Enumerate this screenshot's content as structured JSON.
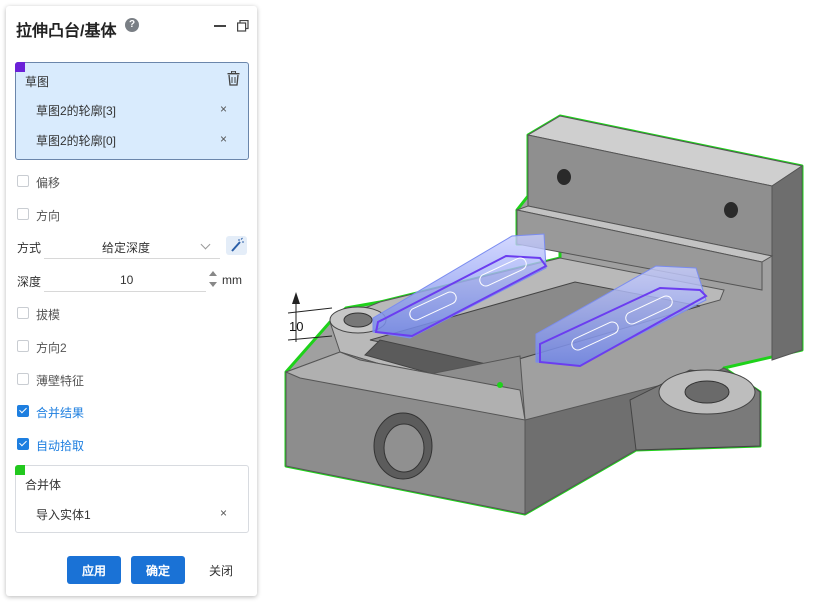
{
  "dialog": {
    "title": "拉伸凸台/基体",
    "help_icon": "question-circle-icon",
    "help_glyph": "?"
  },
  "sketch_box": {
    "label": "草图",
    "items": [
      {
        "label": "草图2的轮廓[3]",
        "remove": "×"
      },
      {
        "label": "草图2的轮廓[0]",
        "remove": "×"
      }
    ],
    "accent": "#6b21d8"
  },
  "options": {
    "offset": {
      "label": "偏移",
      "checked": false
    },
    "direction": {
      "label": "方向",
      "checked": false
    }
  },
  "method": {
    "label": "方式",
    "value": "给定深度"
  },
  "depth": {
    "label": "深度",
    "value": "10",
    "unit": "mm"
  },
  "more_options": {
    "draft": {
      "label": "拔模",
      "checked": false
    },
    "direction2": {
      "label": "方向2",
      "checked": false
    },
    "thin": {
      "label": "薄壁特征",
      "checked": false
    },
    "merge": {
      "label": "合并结果",
      "checked": true
    },
    "auto_pick": {
      "label": "自动拾取",
      "checked": true
    }
  },
  "body_box": {
    "label": "合并体",
    "items": [
      {
        "label": "导入实体1",
        "remove": "×"
      }
    ],
    "accent": "#22c81e"
  },
  "buttons": {
    "apply": "应用",
    "ok": "确定",
    "close": "关闭"
  },
  "viewport": {
    "dimension_label": "10",
    "colors": {
      "part_edge": "#1ed21a",
      "profile": "#6b3df0",
      "preview": "#5a78e6",
      "part_face": "#8e8e8e"
    }
  }
}
